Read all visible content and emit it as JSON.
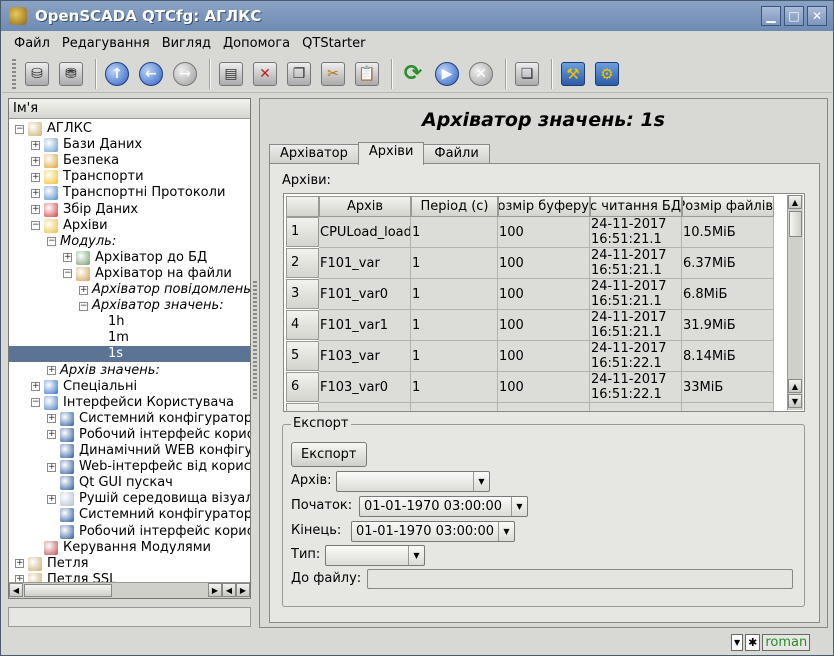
{
  "window": {
    "title": "OpenSCADA QTCfg: АГЛКС"
  },
  "menu": [
    {
      "label": "Файл"
    },
    {
      "label": "Редагування"
    },
    {
      "label": "Вигляд"
    },
    {
      "label": "Допомога"
    },
    {
      "label": "QTStarter"
    }
  ],
  "tree": {
    "header": "Ім'я",
    "nodes": [
      {
        "label": "АГЛКС",
        "level": 0,
        "exp": "−",
        "icon": "#c8b070",
        "italic": false
      },
      {
        "label": "Бази Даних",
        "level": 1,
        "exp": "+",
        "icon": "#6c9ed0",
        "italic": false
      },
      {
        "label": "Безпека",
        "level": 1,
        "exp": "+",
        "icon": "#e0a030",
        "italic": false
      },
      {
        "label": "Транспорти",
        "level": 1,
        "exp": "+",
        "icon": "#f0c020",
        "italic": false
      },
      {
        "label": "Транспортні Протоколи",
        "level": 1,
        "exp": "+",
        "icon": "#5088d0",
        "italic": false
      },
      {
        "label": "Збір Даних",
        "level": 1,
        "exp": "+",
        "icon": "#d04040",
        "italic": false
      },
      {
        "label": "Архіви",
        "level": 1,
        "exp": "−",
        "icon": "#e8c040",
        "italic": false
      },
      {
        "label": "Модуль:",
        "level": 2,
        "exp": "−",
        "icon": "",
        "italic": true
      },
      {
        "label": "Архіватор до БД",
        "level": 3,
        "exp": "+",
        "icon": "#70a070",
        "italic": false
      },
      {
        "label": "Архіватор на файли",
        "level": 3,
        "exp": "−",
        "icon": "#d0a050",
        "italic": false
      },
      {
        "label": "Архіватор повідомлень:",
        "level": 4,
        "exp": "+",
        "icon": "",
        "italic": true
      },
      {
        "label": "Архіватор значень:",
        "level": 4,
        "exp": "−",
        "icon": "",
        "italic": true
      },
      {
        "label": "1h",
        "level": 5,
        "exp": "",
        "icon": "",
        "italic": false
      },
      {
        "label": "1m",
        "level": 5,
        "exp": "",
        "icon": "",
        "italic": false
      },
      {
        "label": "1s",
        "level": 5,
        "exp": "",
        "icon": "",
        "italic": false,
        "selected": true
      },
      {
        "label": "Архів значень:",
        "level": 2,
        "exp": "+",
        "icon": "",
        "italic": true
      },
      {
        "label": "Спеціальні",
        "level": 1,
        "exp": "+",
        "icon": "#3070d0",
        "italic": false
      },
      {
        "label": "Інтерфейси Користувача",
        "level": 1,
        "exp": "−",
        "icon": "#4a80c8",
        "italic": false
      },
      {
        "label": "Системний конфігуратор",
        "level": 2,
        "exp": "+",
        "icon": "#2a5aa0",
        "italic": false
      },
      {
        "label": "Робочий інтерфейс користувача",
        "level": 2,
        "exp": "+",
        "icon": "#2a5aa0",
        "italic": false
      },
      {
        "label": "Динамічний WEB конфігуратор",
        "level": 2,
        "exp": "",
        "icon": "#2a5aa0",
        "italic": false
      },
      {
        "label": "Web-інтерфейс від користувача",
        "level": 2,
        "exp": "+",
        "icon": "#2a5aa0",
        "italic": false
      },
      {
        "label": "Qt GUI пускач",
        "level": 2,
        "exp": "",
        "icon": "#2a5aa0",
        "italic": false
      },
      {
        "label": "Рушій середовища візуалізації",
        "level": 2,
        "exp": "+",
        "icon": "#b0c0d0",
        "italic": false
      },
      {
        "label": "Системний конфігуратор",
        "level": 2,
        "exp": "",
        "icon": "#2a5aa0",
        "italic": false
      },
      {
        "label": "Робочий інтерфейс користувача",
        "level": 2,
        "exp": "",
        "icon": "#2a5aa0",
        "italic": false
      },
      {
        "label": "Керування Модулями",
        "level": 1,
        "exp": "",
        "icon": "#c05050",
        "italic": false
      },
      {
        "label": "Петля",
        "level": 0,
        "exp": "+",
        "icon": "#c8b070",
        "italic": false
      },
      {
        "label": "Петля SSL",
        "level": 0,
        "exp": "+",
        "icon": "#c8b070",
        "italic": false
      }
    ]
  },
  "panel": {
    "title": "Архіватор значень: 1s",
    "tabs": [
      {
        "label": "Архіватор",
        "active": false
      },
      {
        "label": "Архіви",
        "active": true
      },
      {
        "label": "Файли",
        "active": false
      }
    ],
    "archives_label": "Архіви:",
    "columns": [
      "Архів",
      "Період (с)",
      "Розмір буферу",
      "Час читання БД",
      "Розмір файлів"
    ],
    "rows": [
      {
        "n": "1",
        "archive": "CPULoad_load",
        "period": "1",
        "buffer": "100",
        "date": "24-11-2017",
        "time": "16:51:21.1",
        "size": "10.5МіБ"
      },
      {
        "n": "2",
        "archive": "F101_var",
        "period": "1",
        "buffer": "100",
        "date": "24-11-2017",
        "time": "16:51:21.1",
        "size": "6.37МіБ"
      },
      {
        "n": "3",
        "archive": "F101_var0",
        "period": "1",
        "buffer": "100",
        "date": "24-11-2017",
        "time": "16:51:21.1",
        "size": "6.8МіБ"
      },
      {
        "n": "4",
        "archive": "F101_var1",
        "period": "1",
        "buffer": "100",
        "date": "24-11-2017",
        "time": "16:51:21.1",
        "size": "31.9МіБ"
      },
      {
        "n": "5",
        "archive": "F103_var",
        "period": "1",
        "buffer": "100",
        "date": "24-11-2017",
        "time": "16:51:22.1",
        "size": "8.14МіБ"
      },
      {
        "n": "6",
        "archive": "F103_var0",
        "period": "1",
        "buffer": "100",
        "date": "24-11-2017",
        "time": "16:51:22.1",
        "size": "33МіБ"
      },
      {
        "n": "",
        "archive": "",
        "period": "",
        "buffer": "",
        "date": "24-11-2017",
        "time": "",
        "size": ""
      }
    ],
    "export": {
      "group_label": "Експорт",
      "button": "Експорт",
      "archive_label": "Архів:",
      "archive_value": "",
      "start_label": "Початок:",
      "start_value": "01-01-1970 03:00:00",
      "end_label": "Кінець:",
      "end_value": "01-01-1970 03:00:00",
      "type_label": "Тип:",
      "type_value": "",
      "file_label": "До файлу:",
      "file_value": ""
    }
  },
  "status": {
    "user": "roman"
  }
}
